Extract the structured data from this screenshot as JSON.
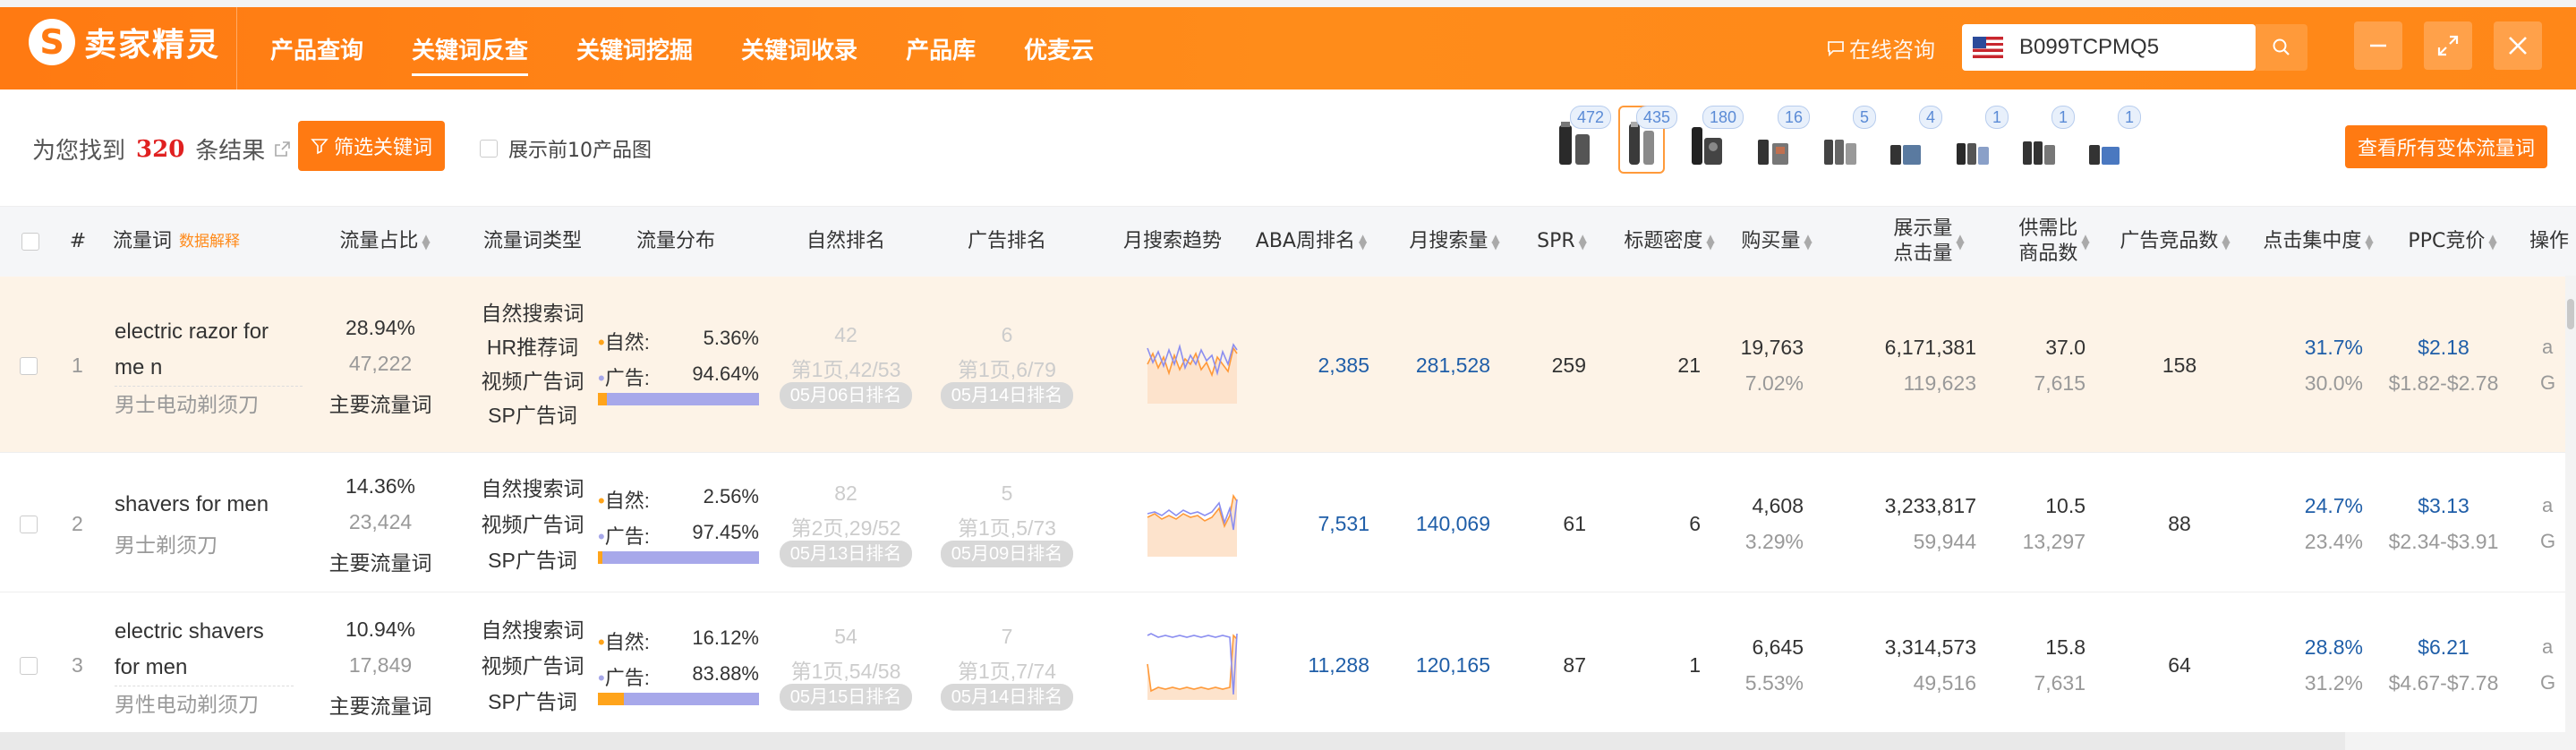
{
  "app": {
    "logo_text": "卖家精灵",
    "logo_letter": "S"
  },
  "nav": [
    {
      "label": "产品查询"
    },
    {
      "label": "关键词反查"
    },
    {
      "label": "关键词挖掘"
    },
    {
      "label": "关键词收录"
    },
    {
      "label": "产品库"
    },
    {
      "label": "优麦云"
    }
  ],
  "consult": {
    "label": "在线咨询"
  },
  "search": {
    "value": "B099TCPMQ5"
  },
  "toolbar": {
    "result_prefix": "为您找到",
    "result_count": "320",
    "result_suffix": "条结果",
    "filter_button": "筛选关键词",
    "show_top_label": "展示前10产品图",
    "variant_button": "查看所有变体流量词",
    "thumb_counts": [
      "472",
      "435",
      "180",
      "16",
      "5",
      "4",
      "1",
      "1",
      "1"
    ]
  },
  "columns": {
    "index": "#",
    "keyword": "流量词",
    "keyword_hint": "数据解释",
    "share": "流量占比",
    "type": "流量词类型",
    "dist": "流量分布",
    "organic_rank": "自然排名",
    "ad_rank": "广告排名",
    "trend": "月搜索趋势",
    "aba": "ABA周排名",
    "monthly": "月搜索量",
    "spr": "SPR",
    "title_density": "标题密度",
    "purchase": "购买量",
    "impressions_1": "展示量",
    "impressions_2": "点击量",
    "supply_1": "供需比",
    "supply_2": "商品数",
    "ad_competitors": "广告竞品数",
    "click_conc": "点击集中度",
    "ppc": "PPC竞价",
    "ops": "操作"
  },
  "dist_labels": {
    "organic": "自然:",
    "ad": "广告:"
  },
  "rows": [
    {
      "index": "1",
      "keyword": "electric razor for me n",
      "translation": "男士电动剃须刀",
      "share": "28.94%",
      "share_count": "47,222",
      "share_type": "主要流量词",
      "types": [
        "自然搜索词",
        "HR推荐词",
        "视频广告词",
        "SP广告词"
      ],
      "organic_pct": "5.36%",
      "ad_pct": "94.64%",
      "organic_frac": 0.0536,
      "organic_rank": "42",
      "organic_page": "第1页,42/53",
      "organic_date": "05月06日排名",
      "ad_rank": "6",
      "ad_page": "第1页,6/79",
      "ad_date": "05月14日排名",
      "aba": "2,385",
      "monthly": "281,528",
      "spr": "259",
      "title_density": "21",
      "purchase": "19,763",
      "purchase_rate": "7.02%",
      "impressions": "6,171,381",
      "clicks": "119,623",
      "supply_ratio": "37.0",
      "products": "7,615",
      "ad_competitors": "158",
      "click_conc": "31.7%",
      "click_conc_sub": "30.0%",
      "ppc": "$2.18",
      "ppc_range": "$1.82-$2.78"
    },
    {
      "index": "2",
      "keyword": "shavers for men",
      "translation": "男士剃须刀",
      "share": "14.36%",
      "share_count": "23,424",
      "share_type": "主要流量词",
      "types": [
        "自然搜索词",
        "视频广告词",
        "SP广告词"
      ],
      "organic_pct": "2.56%",
      "ad_pct": "97.45%",
      "organic_frac": 0.0256,
      "organic_rank": "82",
      "organic_page": "第2页,29/52",
      "organic_date": "05月13日排名",
      "ad_rank": "5",
      "ad_page": "第1页,5/73",
      "ad_date": "05月09日排名",
      "aba": "7,531",
      "monthly": "140,069",
      "spr": "61",
      "title_density": "6",
      "purchase": "4,608",
      "purchase_rate": "3.29%",
      "impressions": "3,233,817",
      "clicks": "59,944",
      "supply_ratio": "10.5",
      "products": "13,297",
      "ad_competitors": "88",
      "click_conc": "24.7%",
      "click_conc_sub": "23.4%",
      "ppc": "$3.13",
      "ppc_range": "$2.34-$3.91"
    },
    {
      "index": "3",
      "keyword": "electric shavers for men",
      "translation": "男性电动剃须刀",
      "share": "10.94%",
      "share_count": "17,849",
      "share_type": "主要流量词",
      "types": [
        "自然搜索词",
        "视频广告词",
        "SP广告词"
      ],
      "organic_pct": "16.12%",
      "ad_pct": "83.88%",
      "organic_frac": 0.1612,
      "organic_rank": "54",
      "organic_page": "第1页,54/58",
      "organic_date": "05月15日排名",
      "ad_rank": "7",
      "ad_page": "第1页,7/74",
      "ad_date": "05月14日排名",
      "aba": "11,288",
      "monthly": "120,165",
      "spr": "87",
      "title_density": "1",
      "purchase": "6,645",
      "purchase_rate": "5.53%",
      "impressions": "3,314,573",
      "clicks": "49,516",
      "supply_ratio": "15.8",
      "products": "7,631",
      "ad_competitors": "64",
      "click_conc": "28.8%",
      "click_conc_sub": "31.2%",
      "ppc": "$6.21",
      "ppc_range": "$4.67-$7.78"
    }
  ],
  "colors": {
    "brand": "#ff7a12",
    "highlight_row": "#fdf3e7",
    "blue_value": "#1f5ea8",
    "ad_bar": "#a7a8ea",
    "organic_bar": "#ffa41b"
  }
}
